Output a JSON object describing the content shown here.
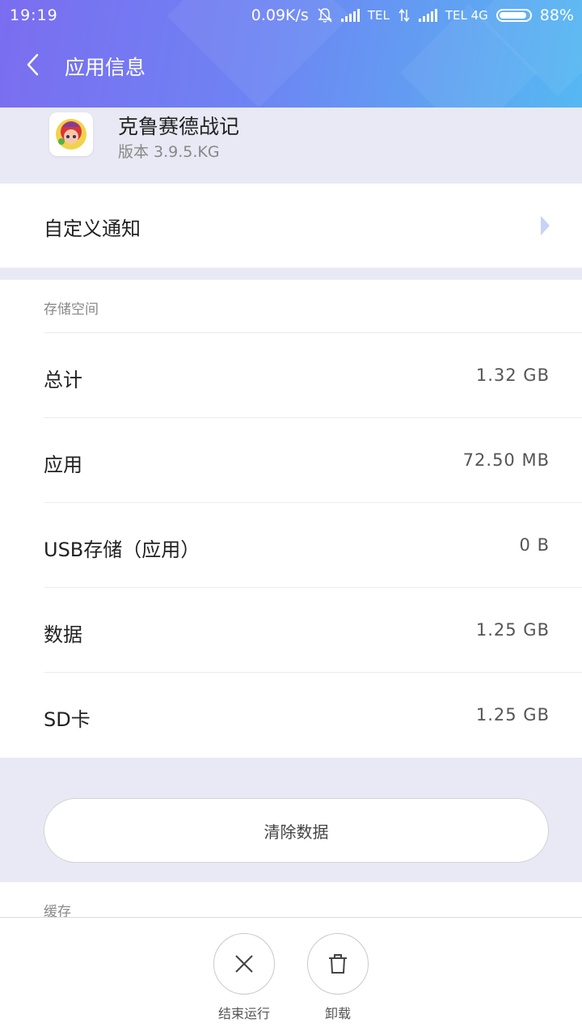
{
  "status_bar": {
    "time": "19:19",
    "speed": "0.09K/s",
    "carrier1": "TEL",
    "carrier2": "TEL 4G",
    "battery": "88%"
  },
  "header": {
    "title": "应用信息",
    "back_icon": "chevron-left-icon"
  },
  "app": {
    "name": "克鲁赛德战记",
    "version": "版本 3.9.5.KG"
  },
  "notification": {
    "label": "自定义通知",
    "arrow_icon": "triangle-right-icon"
  },
  "storage": {
    "section_label": "存储空间",
    "rows": [
      {
        "label": "总计",
        "value": "1.32 GB"
      },
      {
        "label": "应用",
        "value": "72.50 MB"
      },
      {
        "label": "USB存储（应用）",
        "value": "0 B"
      },
      {
        "label": "数据",
        "value": "1.25 GB"
      },
      {
        "label": "SD卡",
        "value": "1.25 GB"
      }
    ]
  },
  "clear_data_label": "清除数据",
  "cache": {
    "section_label": "缓存"
  },
  "bottom_actions": {
    "force_stop": "结束运行",
    "uninstall": "卸载"
  },
  "colors": {
    "header_start": "#7b6df0",
    "header_end": "#55b8f2",
    "background": "#e8e9f4",
    "arrow": "#c8d2f7"
  }
}
